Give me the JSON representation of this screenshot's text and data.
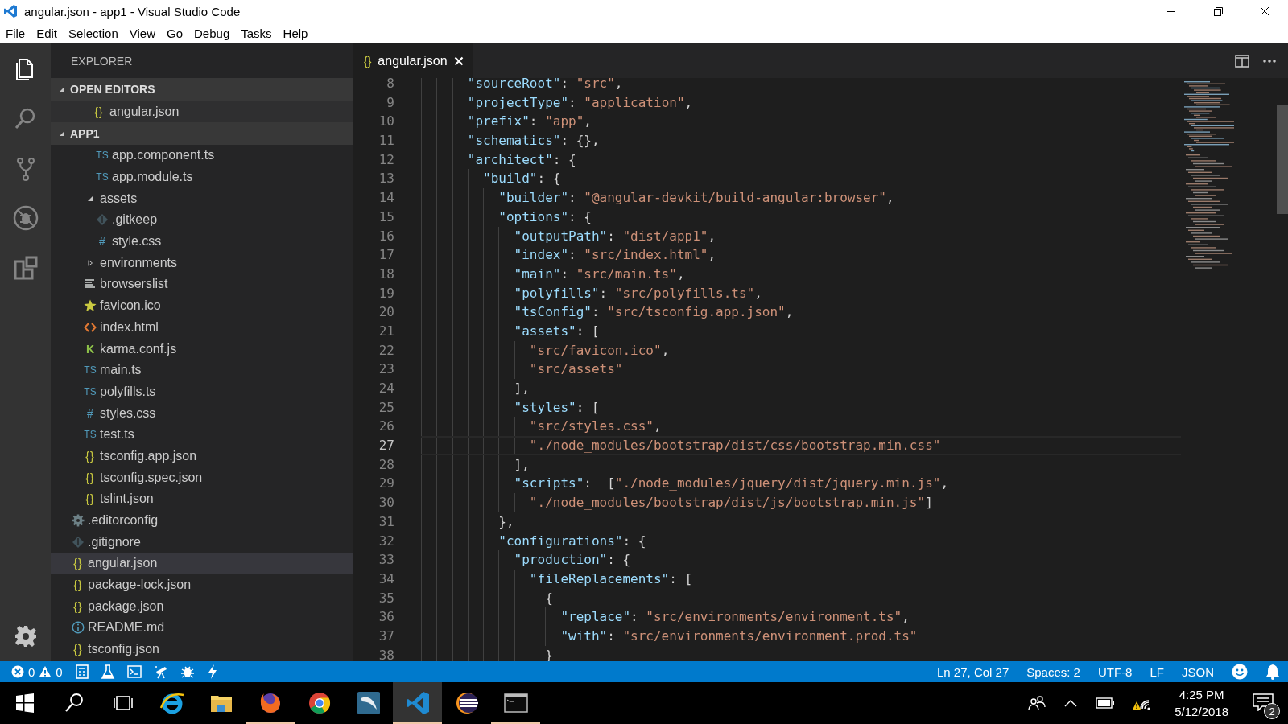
{
  "window": {
    "title": "angular.json - app1 - Visual Studio Code"
  },
  "menu": [
    "File",
    "Edit",
    "Selection",
    "View",
    "Go",
    "Debug",
    "Tasks",
    "Help"
  ],
  "activity_bar": [
    {
      "kind": "explorer",
      "selected": true
    },
    {
      "kind": "search",
      "selected": false
    },
    {
      "kind": "scm",
      "selected": false
    },
    {
      "kind": "debug",
      "selected": false
    },
    {
      "kind": "extensions",
      "selected": false
    }
  ],
  "sidebar": {
    "title": "EXPLORER",
    "open_editors": {
      "title": "OPEN EDITORS",
      "expanded": true,
      "items": [
        {
          "label": "angular.json",
          "kind": "json",
          "icon": "{}"
        }
      ]
    },
    "project": {
      "title": "APP1",
      "expanded": true,
      "tree": [
        {
          "children": [
            {
              "children": [
                {
                  "label": "app.component.ts",
                  "kind": "ts",
                  "icon": "TS",
                  "selected": false
                },
                {
                  "label": "app.module.ts",
                  "kind": "ts",
                  "icon": "TS",
                  "selected": false
                }
              ]
            },
            {
              "label": "assets",
              "kind": "folder",
              "expanded": true,
              "selected": false,
              "children": [
                {
                  "label": ".gitkeep",
                  "kind": "git",
                  "selected": false
                },
                {
                  "label": "style.css",
                  "kind": "css",
                  "icon": "#",
                  "selected": false
                }
              ]
            },
            {
              "label": "environments",
              "kind": "folder",
              "expanded": false,
              "selected": false
            },
            {
              "label": "browserslist",
              "kind": "list",
              "selected": false
            },
            {
              "label": "favicon.ico",
              "kind": "star",
              "selected": false
            },
            {
              "label": "index.html",
              "kind": "html",
              "selected": false
            },
            {
              "label": "karma.conf.js",
              "kind": "karma",
              "icon": "K",
              "selected": false
            },
            {
              "label": "main.ts",
              "kind": "ts",
              "icon": "TS",
              "selected": false
            },
            {
              "label": "polyfills.ts",
              "kind": "ts",
              "icon": "TS",
              "selected": false
            },
            {
              "label": "styles.css",
              "kind": "css",
              "icon": "#",
              "selected": false
            },
            {
              "label": "test.ts",
              "kind": "ts",
              "icon": "TS",
              "selected": false
            },
            {
              "label": "tsconfig.app.json",
              "kind": "json",
              "icon": "{}",
              "selected": false
            },
            {
              "label": "tsconfig.spec.json",
              "kind": "json",
              "icon": "{}",
              "selected": false
            },
            {
              "label": "tslint.json",
              "kind": "json",
              "icon": "{}",
              "selected": false
            }
          ]
        },
        {
          "label": ".editorconfig",
          "kind": "config",
          "selected": false
        },
        {
          "label": ".gitignore",
          "kind": "git",
          "selected": false
        },
        {
          "label": "angular.json",
          "kind": "json",
          "icon": "{}",
          "selected": true
        },
        {
          "label": "package-lock.json",
          "kind": "json",
          "icon": "{}",
          "selected": false
        },
        {
          "label": "package.json",
          "kind": "json",
          "icon": "{}",
          "selected": false
        },
        {
          "label": "README.md",
          "kind": "info",
          "selected": false
        },
        {
          "label": "tsconfig.json",
          "kind": "json",
          "icon": "{}",
          "selected": false
        }
      ]
    }
  },
  "editor": {
    "tabs": [
      {
        "label": "angular.json",
        "kind": "json",
        "icon": "{}",
        "selected": true
      }
    ],
    "lines": [
      {
        "number": "8",
        "text": "      \"sourceRoot\": \"src\",",
        "current": false
      },
      {
        "number": "9",
        "text": "      \"projectType\": \"application\",",
        "current": false
      },
      {
        "number": "10",
        "text": "      \"prefix\": \"app\",",
        "current": false
      },
      {
        "number": "11",
        "text": "      \"schematics\": {},",
        "current": false
      },
      {
        "number": "12",
        "text": "      \"architect\": {",
        "current": false
      },
      {
        "number": "13",
        "text": "        \"build\": {",
        "current": false
      },
      {
        "number": "14",
        "text": "          \"builder\": \"@angular-devkit/build-angular:browser\",",
        "current": false
      },
      {
        "number": "15",
        "text": "          \"options\": {",
        "current": false
      },
      {
        "number": "16",
        "text": "            \"outputPath\": \"dist/app1\",",
        "current": false
      },
      {
        "number": "17",
        "text": "            \"index\": \"src/index.html\",",
        "current": false
      },
      {
        "number": "18",
        "text": "            \"main\": \"src/main.ts\",",
        "current": false
      },
      {
        "number": "19",
        "text": "            \"polyfills\": \"src/polyfills.ts\",",
        "current": false
      },
      {
        "number": "20",
        "text": "            \"tsConfig\": \"src/tsconfig.app.json\",",
        "current": false
      },
      {
        "number": "21",
        "text": "            \"assets\": [",
        "current": false
      },
      {
        "number": "22",
        "text": "              \"src/favicon.ico\",",
        "current": false
      },
      {
        "number": "23",
        "text": "              \"src/assets\"",
        "current": false
      },
      {
        "number": "24",
        "text": "            ],",
        "current": false
      },
      {
        "number": "25",
        "text": "            \"styles\": [",
        "current": false
      },
      {
        "number": "26",
        "text": "              \"src/styles.css\",",
        "current": false
      },
      {
        "number": "27",
        "text": "              \"./node_modules/bootstrap/dist/css/bootstrap.min.css\"",
        "current": true
      },
      {
        "number": "28",
        "text": "            ],",
        "current": false
      },
      {
        "number": "29",
        "text": "            \"scripts\":  [\"./node_modules/jquery/dist/jquery.min.js\",",
        "current": false
      },
      {
        "number": "30",
        "text": "              \"./node_modules/bootstrap/dist/js/bootstrap.min.js\"]",
        "current": false
      },
      {
        "number": "31",
        "text": "          },",
        "current": false
      },
      {
        "number": "32",
        "text": "          \"configurations\": {",
        "current": false
      },
      {
        "number": "33",
        "text": "            \"production\": {",
        "current": false
      },
      {
        "number": "34",
        "text": "              \"fileReplacements\": [",
        "current": false
      },
      {
        "number": "35",
        "text": "                {",
        "current": false
      },
      {
        "number": "36",
        "text": "                  \"replace\": \"src/environments/environment.ts\",",
        "current": false
      },
      {
        "number": "37",
        "text": "                  \"with\": \"src/environments/environment.prod.ts\"",
        "current": false
      },
      {
        "number": "38",
        "text": "                }",
        "current": false
      }
    ]
  },
  "status_bar": {
    "errors": "0",
    "warnings": "0",
    "right": [
      "Ln 27, Col 27",
      "Spaces: 2",
      "UTF-8",
      "LF",
      "JSON"
    ]
  },
  "taskbar": {
    "apps": [
      {
        "kind": "browser-e",
        "running": false,
        "selected": false
      },
      {
        "kind": "folder",
        "running": false,
        "selected": false
      },
      {
        "kind": "fox",
        "running": true,
        "selected": false
      },
      {
        "kind": "chrome",
        "running": false,
        "selected": false
      },
      {
        "kind": "dolphin",
        "running": false,
        "selected": false
      },
      {
        "kind": "code",
        "running": true,
        "selected": true
      },
      {
        "kind": "eclipse",
        "running": false,
        "selected": false
      },
      {
        "kind": "terminal",
        "running": true,
        "selected": false
      }
    ],
    "time": "4:25 PM",
    "date": "5/12/2018",
    "notifications": "2"
  }
}
